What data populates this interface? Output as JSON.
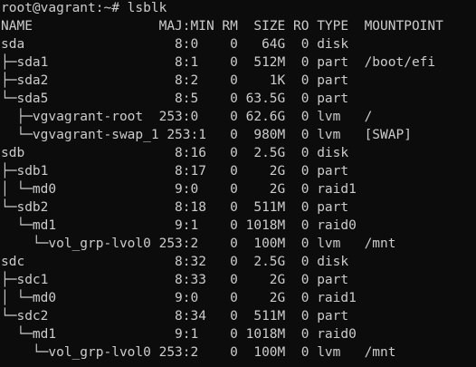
{
  "terminal": {
    "background": "#0c0c0c",
    "foreground": "#cccccc",
    "lines": [
      "root@vagrant:~# lsblk",
      "NAME                MAJ:MIN RM  SIZE RO TYPE  MOUNTPOINT",
      "sda                   8:0    0   64G  0 disk",
      "├─sda1                8:1    0  512M  0 part  /boot/efi",
      "├─sda2                8:2    0    1K  0 part",
      "└─sda5                8:5    0 63.5G  0 part",
      "  ├─vgvagrant-root  253:0    0 62.6G  0 lvm   /",
      "  └─vgvagrant-swap_1 253:1   0  980M  0 lvm   [SWAP]",
      "sdb                   8:16   0  2.5G  0 disk",
      "├─sdb1                8:17   0    2G  0 part",
      "│ └─md0               9:0    0    2G  0 raid1",
      "└─sdb2                8:18   0  511M  0 part",
      "  └─md1               9:1    0 1018M  0 raid0",
      "    └─vol_grp-lvol0 253:2    0  100M  0 lvm   /mnt",
      "sdc                   8:32   0  2.5G  0 disk",
      "├─sdc1                8:33   0    2G  0 part",
      "│ └─md0               9:0    0    2G  0 raid1",
      "└─sdc2                8:34   0  511M  0 part",
      "  └─md1               9:1    0 1018M  0 raid0",
      "    └─vol_grp-lvol0 253:2    0  100M  0 lvm   /mnt",
      "    "
    ]
  }
}
